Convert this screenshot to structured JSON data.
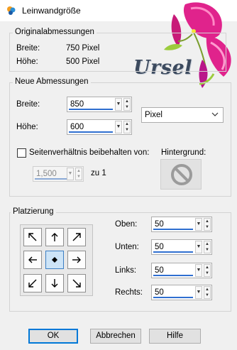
{
  "window": {
    "title": "Leinwandgröße"
  },
  "decoration": {
    "signature_text": "Ursel"
  },
  "original": {
    "legend": "Originalabmessungen",
    "width_label": "Breite:",
    "width_value": "750 Pixel",
    "height_label": "Höhe:",
    "height_value": "500 Pixel"
  },
  "new_dims": {
    "legend": "Neue Abmessungen",
    "width_label": "Breite:",
    "width_value": "850",
    "height_label": "Höhe:",
    "height_value": "600",
    "unit_selected": "Pixel",
    "keep_ratio_label": "Seitenverhältnis beibehalten von:",
    "keep_ratio_checked": false,
    "ratio_value": "1,500",
    "ratio_suffix": "zu 1",
    "background_label": "Hintergrund:"
  },
  "placement": {
    "legend": "Platzierung",
    "grid": [
      {
        "name": "top-left",
        "icon": "arrow-up-left-icon"
      },
      {
        "name": "top-center",
        "icon": "arrow-up-icon"
      },
      {
        "name": "top-right",
        "icon": "arrow-up-right-icon"
      },
      {
        "name": "middle-left",
        "icon": "arrow-left-icon"
      },
      {
        "name": "center",
        "icon": "center-dot-icon",
        "selected": true
      },
      {
        "name": "middle-right",
        "icon": "arrow-right-icon"
      },
      {
        "name": "bottom-left",
        "icon": "arrow-down-left-icon"
      },
      {
        "name": "bottom-center",
        "icon": "arrow-down-icon"
      },
      {
        "name": "bottom-right",
        "icon": "arrow-down-right-icon"
      }
    ],
    "top_label": "Oben:",
    "top_value": "50",
    "bottom_label": "Unten:",
    "bottom_value": "50",
    "left_label": "Links:",
    "left_value": "50",
    "right_label": "Rechts:",
    "right_value": "50"
  },
  "buttons": {
    "ok": "OK",
    "cancel": "Abbrechen",
    "help": "Hilfe"
  },
  "colors": {
    "accent": "#2f6fd0",
    "selected_cell": "#cde4f7",
    "flower": "#e0238c"
  }
}
